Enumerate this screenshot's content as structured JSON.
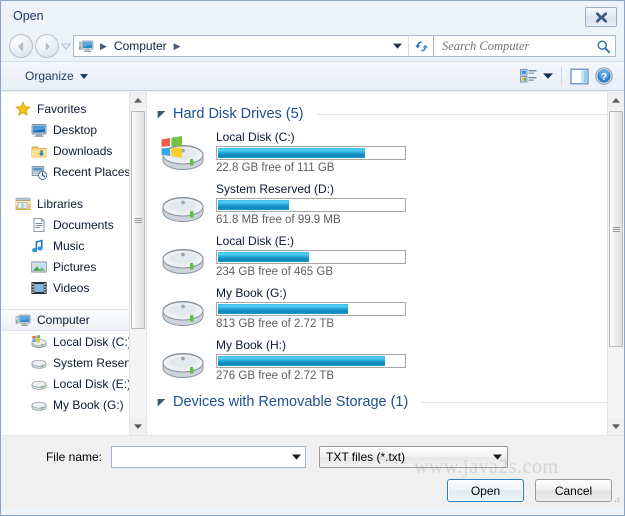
{
  "window": {
    "title": "Open",
    "close_tooltip": "Close"
  },
  "nav": {
    "back_label": "Back",
    "forward_label": "Forward",
    "recent_label": "Recent pages",
    "refresh_label": "Refresh",
    "breadcrumb": {
      "computer_icon": "computer-icon",
      "items": [
        "Computer"
      ],
      "separator": "▶"
    }
  },
  "search": {
    "placeholder": "Search Computer",
    "value": "",
    "icon": "search-icon"
  },
  "toolbar": {
    "organize_label": "Organize",
    "organize_caret": "▼",
    "views_icon": "views-icon",
    "views_caret": "▼",
    "preview_pane_icon": "preview-pane-icon",
    "help_icon": "help-icon"
  },
  "sidebar": {
    "groups": [
      {
        "label": "Favorites",
        "icon": "star-icon",
        "items": [
          {
            "label": "Desktop",
            "icon": "desktop-icon"
          },
          {
            "label": "Downloads",
            "icon": "downloads-icon"
          },
          {
            "label": "Recent Places",
            "icon": "recent-places-icon"
          }
        ]
      },
      {
        "label": "Libraries",
        "icon": "libraries-icon",
        "items": [
          {
            "label": "Documents",
            "icon": "documents-icon"
          },
          {
            "label": "Music",
            "icon": "music-icon"
          },
          {
            "label": "Pictures",
            "icon": "pictures-icon"
          },
          {
            "label": "Videos",
            "icon": "videos-icon"
          }
        ]
      },
      {
        "label": "Computer",
        "icon": "computer-icon",
        "selected": true,
        "items": [
          {
            "label": "Local Disk (C:)",
            "icon": "system-drive-icon"
          },
          {
            "label": "System Reserved",
            "icon": "drive-icon"
          },
          {
            "label": "Local Disk (E:)",
            "icon": "drive-icon"
          },
          {
            "label": "My Book (G:)",
            "icon": "drive-icon"
          }
        ]
      }
    ]
  },
  "content": {
    "groups": [
      {
        "title": "Hard Disk Drives (5)",
        "expanded": true,
        "drives": [
          {
            "name": "Local Disk (C:)",
            "subtitle": "22.8 GB free of 111 GB",
            "free": "22.8 GB",
            "total": "111 GB",
            "used_percent": 79,
            "icon": "system-drive-icon",
            "bar_color": "#22a8d8"
          },
          {
            "name": "System Reserved (D:)",
            "subtitle": "61.8 MB free of 99.9 MB",
            "free": "61.8 MB",
            "total": "99.9 MB",
            "used_percent": 38,
            "icon": "drive-icon",
            "bar_color": "#22a8d8"
          },
          {
            "name": "Local Disk (E:)",
            "subtitle": "234 GB free of 465 GB",
            "free": "234 GB",
            "total": "465 GB",
            "used_percent": 49,
            "icon": "drive-icon",
            "bar_color": "#22a8d8"
          },
          {
            "name": "My Book (G:)",
            "subtitle": "813 GB free of 2.72 TB",
            "free": "813 GB",
            "total": "2.72 TB",
            "used_percent": 70,
            "icon": "drive-icon",
            "bar_color": "#22a8d8"
          },
          {
            "name": "My Book (H:)",
            "subtitle": "276 GB free of 2.72 TB",
            "free": "276 GB",
            "total": "2.72 TB",
            "used_percent": 90,
            "icon": "drive-icon",
            "bar_color": "#22a8d8"
          }
        ]
      },
      {
        "title": "Devices with Removable Storage (1)",
        "expanded": true,
        "drives": []
      }
    ]
  },
  "footer": {
    "file_name_label": "File name:",
    "file_name_value": "",
    "file_name_placeholder": "",
    "file_type_value": "TXT files (*.txt)",
    "file_type_options": [
      "TXT files (*.txt)"
    ],
    "open_label": "Open",
    "cancel_label": "Cancel"
  },
  "watermark": {
    "text": "www.java2s.com"
  },
  "colors": {
    "accent": "#1e5090",
    "bar_fill": "#22a8d8",
    "window_frame": "#8ba3c7",
    "title_text": "#1d3a63"
  }
}
